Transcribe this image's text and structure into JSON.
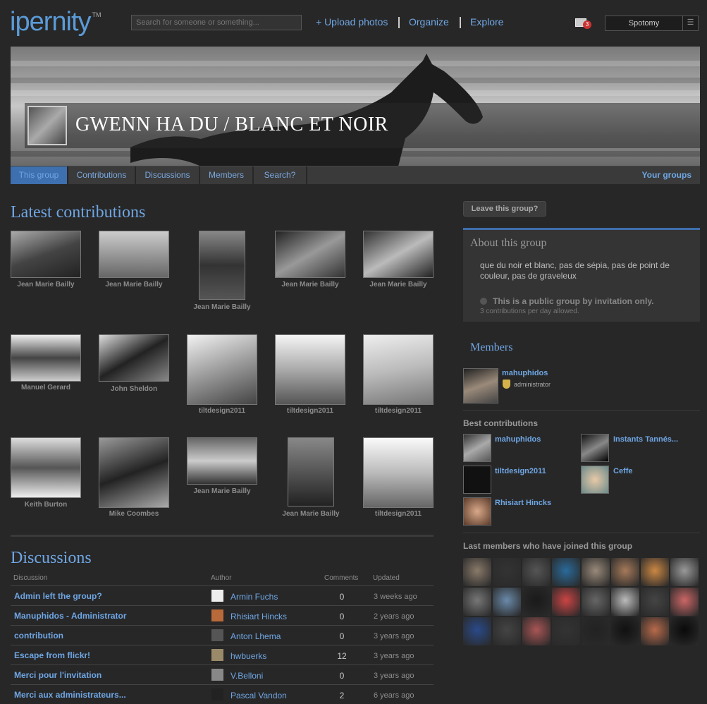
{
  "header": {
    "logo": "ipernity",
    "logo_tm": "TM",
    "search_placeholder": "Search for someone or something...",
    "nav": [
      "+ Upload photos",
      "Organize",
      "Explore"
    ],
    "mail_count": "3",
    "user": "Spotomy"
  },
  "banner": {
    "title": "GWENN HA DU / BLANC ET NOIR"
  },
  "tabs": [
    {
      "label": "This group",
      "active": true
    },
    {
      "label": "Contributions",
      "active": false
    },
    {
      "label": "Discussions",
      "active": false
    },
    {
      "label": "Members",
      "active": false
    },
    {
      "label": "Search?",
      "active": false
    }
  ],
  "your_groups": "Your groups",
  "latest": {
    "heading": "Latest contributions",
    "items": [
      {
        "author": "Jean Marie Bailly"
      },
      {
        "author": "Jean Marie Bailly"
      },
      {
        "author": "Jean Marie Bailly"
      },
      {
        "author": "Jean Marie Bailly"
      },
      {
        "author": "Jean Marie Bailly"
      },
      {
        "author": "Manuel Gerard"
      },
      {
        "author": "John Sheldon"
      },
      {
        "author": "tiltdesign2011"
      },
      {
        "author": "tiltdesign2011"
      },
      {
        "author": "tiltdesign2011"
      },
      {
        "author": "Keith Burton"
      },
      {
        "author": "Mike Coombes"
      },
      {
        "author": "Jean Marie Bailly"
      },
      {
        "author": "Jean Marie Bailly"
      },
      {
        "author": "tiltdesign2011"
      }
    ]
  },
  "discussions": {
    "heading": "Discussions",
    "columns": [
      "Discussion",
      "Author",
      "Comments",
      "Updated"
    ],
    "rows": [
      {
        "title": "Admin left the group?",
        "author": "Armin Fuchs",
        "comments": "0",
        "updated": "3 weeks ago"
      },
      {
        "title": "Manuphidos - Administrator",
        "author": "Rhisiart Hincks",
        "comments": "0",
        "updated": "2 years ago"
      },
      {
        "title": "contribution",
        "author": "Anton Lhema",
        "comments": "0",
        "updated": "3 years ago"
      },
      {
        "title": "Escape from flickr!",
        "author": "hwbuerks",
        "comments": "12",
        "updated": "3 years ago"
      },
      {
        "title": "Merci pour l'invitation",
        "author": "V.Belloni",
        "comments": "0",
        "updated": "3 years ago"
      },
      {
        "title": "Merci aux administrateurs...",
        "author": "Pascal Vandon",
        "comments": "2",
        "updated": "6 years ago"
      }
    ]
  },
  "sidebar": {
    "leave_button": "Leave this group?",
    "about_title": "About this group",
    "about_desc": "que du noir et blanc, pas de sépia, pas de point de couleur, pas de graveleux",
    "public_note": "This is a public group by invitation only.",
    "limit_note": "3 contributions per day allowed.",
    "members_title": "Members",
    "admin_name": "mahuphidos",
    "admin_role": "administrator",
    "best_title": "Best contributions",
    "best": [
      "mahuphidos",
      "Instants Tannés...",
      "tiltdesign2011",
      "Ceffe",
      "Rhisiart Hincks"
    ],
    "last_title": "Last members who have joined this group"
  }
}
